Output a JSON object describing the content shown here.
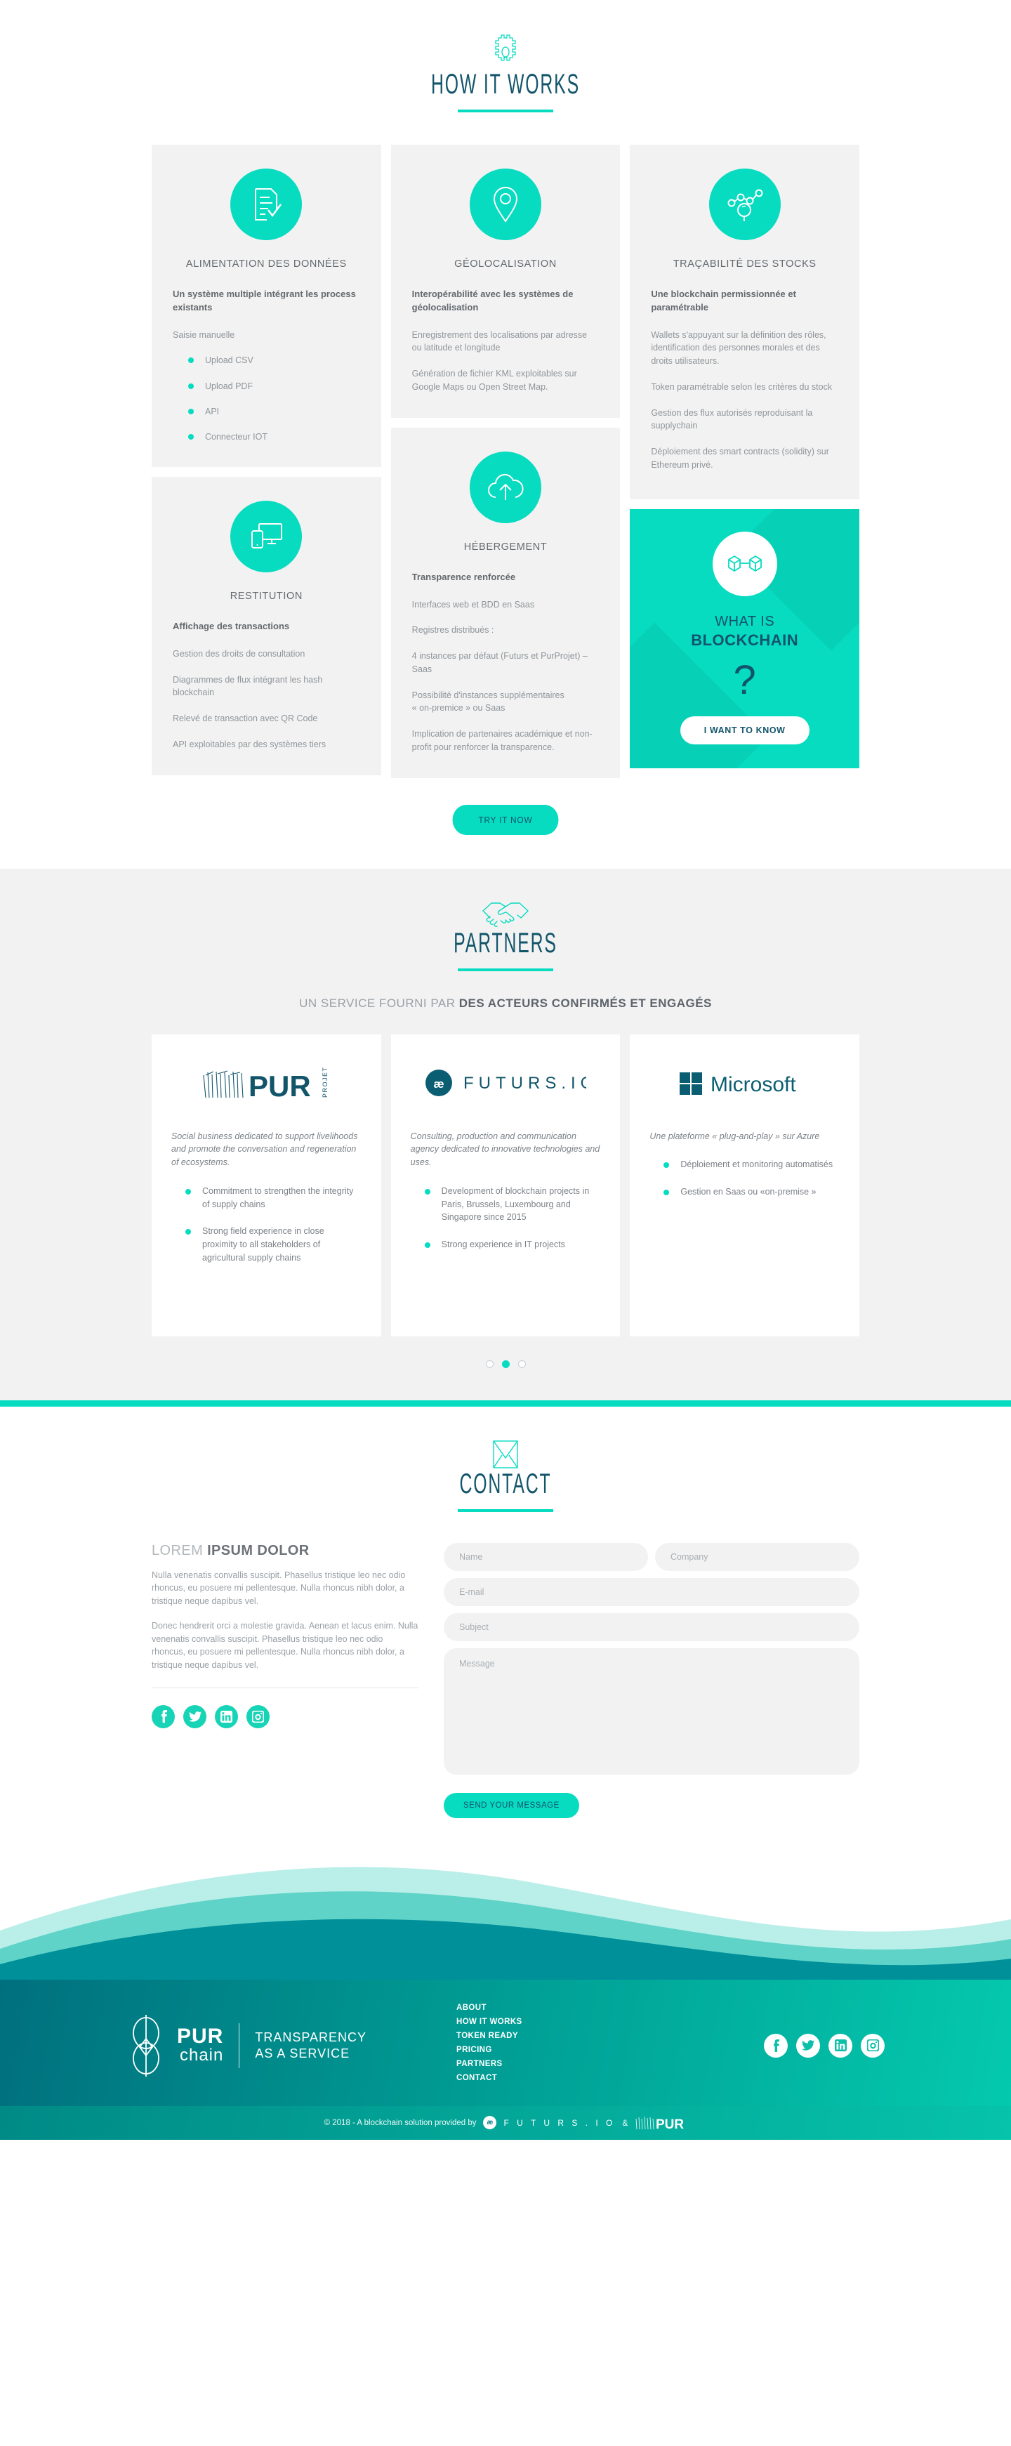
{
  "how": {
    "icon": "gear-icon",
    "title": "HOW IT WORKS",
    "cards": [
      {
        "icon": "document-check-icon",
        "title": "ALIMENTATION DES DONNÉES",
        "lead": "Un système multiple intégrant les process existants",
        "paragraphs": [
          "Saisie manuelle"
        ],
        "bullets": [
          "Upload CSV",
          "Upload PDF",
          "API",
          "Connecteur IOT"
        ]
      },
      {
        "icon": "map-pin-icon",
        "title": "GÉOLOCALISATION",
        "lead": "Interopérabilité avec les systèmes de géolocalisation",
        "paragraphs": [
          "Enregistrement des localisations par adresse ou latitude et longitude",
          "Génération de fichier KML exploitables sur Google Maps ou Open Street Map."
        ],
        "bullets": []
      },
      {
        "icon": "network-search-icon",
        "title": "TRAÇABILITÉ DES STOCKS",
        "lead": "Une blockchain permissionnée et paramétrable",
        "paragraphs": [
          "Wallets s'appuyant sur la définition des rôles, identification des personnes morales et des droits utilisateurs.",
          "Token paramétrable selon les critères du stock",
          "Gestion des flux autorisés reproduisant la supplychain",
          "Déploiement des smart contracts (solidity) sur Ethereum privé."
        ],
        "bullets": []
      },
      {
        "icon": "devices-icon",
        "title": "RESTITUTION",
        "lead": "Affichage des transactions",
        "paragraphs": [
          "Gestion des droits de consultation",
          "Diagrammes de flux intégrant les hash blockchain",
          "Relevé de transaction avec QR Code",
          "API exploitables par des systèmes tiers"
        ],
        "bullets": []
      },
      {
        "icon": "cloud-upload-icon",
        "title": "HÉBERGEMENT",
        "lead": "Transparence renforcée",
        "paragraphs": [
          "Interfaces web et BDD en Saas",
          "Registres distribués :",
          "4 instances par défaut (Futurs et PurProjet) – Saas",
          "Possibilité d'instances supplémentaires\n« on-premice » ou Saas",
          "Implication de partenaires académique et non-profit pour renforcer la transparence."
        ],
        "bullets": []
      }
    ],
    "promo": {
      "icon": "blocks-link-icon",
      "line1": "WHAT IS",
      "line2": "BLOCKCHAIN",
      "question": "?",
      "button": "I WANT TO KNOW"
    },
    "try_button": "TRY IT NOW"
  },
  "partners": {
    "icon": "handshake-icon",
    "title": "PARTNERS",
    "subtitle_light": "UN SERVICE FOURNI PAR",
    "subtitle_bold": "DES ACTEURS CONFIRMÉS ET ENGAGÉS",
    "cards": [
      {
        "logo": "pur-projet-logo",
        "logo_text": "PUR",
        "logo_sub": "PROJET",
        "description": "Social business dedicated to support livelihoods and promote the conversation and regeneration of ecosystems.",
        "bullets": [
          "Commitment to strengthen the integrity of supply chains",
          "Strong field experience in close proximity to all stakeholders of agricultural supply chains"
        ]
      },
      {
        "logo": "futurs-io-logo",
        "logo_text": "F U T U R S . I O",
        "description": "Consulting, production and communication agency dedicated to innovative technologies and uses.",
        "bullets": [
          "Development of blockchain projects in Paris, Brussels, Luxembourg and Singapore since 2015",
          "Strong experience in IT projects"
        ]
      },
      {
        "logo": "microsoft-logo",
        "logo_text": "Microsoft",
        "description": "Une plateforme « plug-and-play » sur Azure",
        "bullets": [
          "Déploiement et monitoring automatisés",
          "Gestion en Saas ou «on-premise »"
        ]
      }
    ],
    "carousel_dots": 3,
    "carousel_active": 1
  },
  "contact": {
    "icon": "envelope-icon",
    "title": "CONTACT",
    "heading_light": "LOREM",
    "heading_bold": "IPSUM DOLOR",
    "paragraphs": [
      "Nulla venenatis convallis suscipit. Phasellus tristique leo nec odio rhoncus, eu posuere mi pellentesque. Nulla rhoncus nibh dolor, a tristique neque dapibus vel.",
      "Donec hendrerit orci a molestie gravida. Aenean et lacus enim. Nulla venenatis convallis suscipit. Phasellus tristique leo nec odio rhoncus, eu posuere mi pellentesque. Nulla rhoncus nibh dolor, a tristique neque dapibus vel."
    ],
    "socials": [
      "facebook-icon",
      "twitter-icon",
      "linkedin-icon",
      "instagram-icon"
    ],
    "form": {
      "name_placeholder": "Name",
      "company_placeholder": "Company",
      "email_placeholder": "E-mail",
      "subject_placeholder": "Subject",
      "message_placeholder": "Message",
      "submit_label": "SEND YOUR MESSAGE"
    }
  },
  "footer": {
    "brand_pur": "PUR",
    "brand_chain": "chain",
    "tagline_line1": "TRANSPARENCY",
    "tagline_line2": "AS A SERVICE",
    "nav": [
      "ABOUT",
      "HOW IT WORKS",
      "TOKEN READY",
      "PRICING",
      "PARTNERS",
      "CONTACT"
    ],
    "socials": [
      "facebook-icon",
      "twitter-icon",
      "linkedin-icon",
      "instagram-icon"
    ],
    "copyright": "© 2018 - A blockchain solution provided by",
    "credit_futurs": "F U T U R S . I O",
    "credit_amp": "&",
    "credit_pur": "PUR"
  },
  "colors": {
    "accent": "#07dbc0",
    "dark_teal": "#12556b",
    "card_bg": "#f2f2f2",
    "text_grey": "#90959a"
  }
}
